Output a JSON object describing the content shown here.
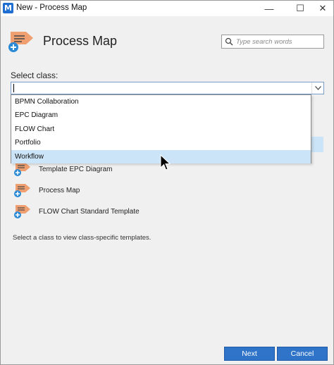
{
  "window": {
    "title": "New - Process Map",
    "app_icon_letter": "M",
    "minimize_glyph": "—",
    "maximize_glyph": "☐",
    "close_glyph": "✕"
  },
  "header": {
    "title": "Process Map",
    "icon": "process-map-icon"
  },
  "search": {
    "placeholder": "Type search words",
    "value": ""
  },
  "class_select": {
    "label": "Select class:",
    "value": "",
    "options": [
      "BPMN Collaboration",
      "EPC Diagram",
      "FLOW Chart",
      "Portfolio",
      "Workflow"
    ],
    "highlighted_index": 4
  },
  "templates": [
    {
      "label": "",
      "selected": true
    },
    {
      "label": "Template EPC Diagram",
      "selected": false
    },
    {
      "label": "Process Map",
      "selected": false
    },
    {
      "label": "FLOW Chart Standard Template",
      "selected": false
    }
  ],
  "hint": "Select a class to view class-specific templates.",
  "buttons": {
    "next": "Next",
    "cancel": "Cancel"
  },
  "colors": {
    "accent": "#2f74c8",
    "selection": "#cce4f7",
    "icon_orange": "#f0a070",
    "icon_blue": "#2b8ad6"
  }
}
